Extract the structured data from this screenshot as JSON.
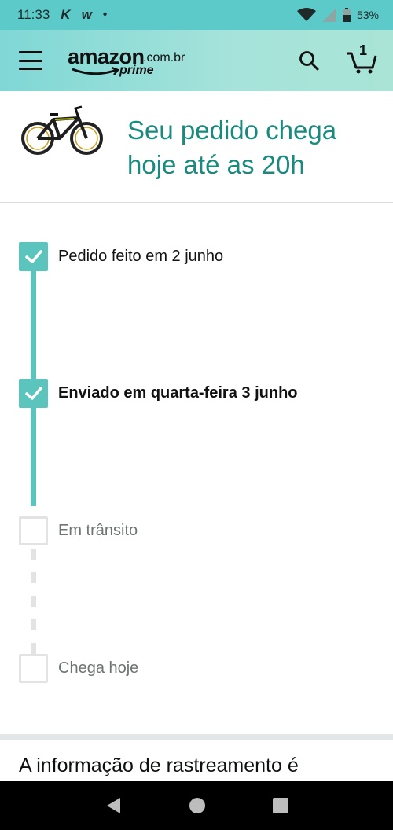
{
  "status_bar": {
    "time": "11:33",
    "notifications": [
      "K",
      "w"
    ],
    "battery": "53%"
  },
  "header": {
    "logo_word": "amazon",
    "logo_tld": ".com.br",
    "logo_sub": "prime",
    "cart_count": "1"
  },
  "banner": {
    "headline": "Seu pedido chega hoje até as 20h",
    "product_image": "bicycle"
  },
  "timeline": {
    "steps": [
      {
        "label": "Pedido feito em 2 junho",
        "status": "done"
      },
      {
        "label": "Enviado em quarta-feira 3 junho",
        "status": "done"
      },
      {
        "label": "Em trânsito",
        "status": "pending"
      },
      {
        "label": "Chega hoje",
        "status": "pending"
      }
    ]
  },
  "tracking_info": "A informação de rastreamento é",
  "colors": {
    "accent": "#5bc5bd",
    "headline": "#1a8a7f",
    "status_bar": "#5ccac8",
    "header_gradient_start": "#7fd7d6",
    "header_gradient_end": "#a9e4d6"
  },
  "icons": [
    "menu-icon",
    "search-icon",
    "cart-icon",
    "check-icon",
    "back-icon",
    "home-icon",
    "recents-icon",
    "wifi-icon",
    "signal-icon",
    "battery-icon"
  ]
}
